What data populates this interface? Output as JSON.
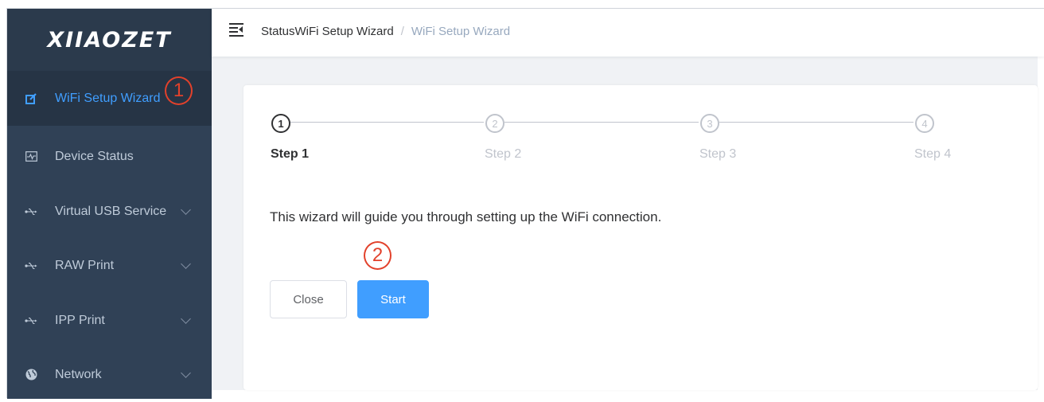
{
  "sidebar": {
    "logo": "XIIAOZET",
    "items": [
      {
        "label": "WiFi Setup Wizard",
        "icon": "edit-square-icon",
        "active": true,
        "has_chevron": false
      },
      {
        "label": "Device Status",
        "icon": "monitor-pulse-icon",
        "active": false,
        "has_chevron": false
      },
      {
        "label": "Virtual USB Service",
        "icon": "usb-icon",
        "active": false,
        "has_chevron": true
      },
      {
        "label": "RAW Print",
        "icon": "usb-icon",
        "active": false,
        "has_chevron": true
      },
      {
        "label": "IPP Print",
        "icon": "usb-icon",
        "active": false,
        "has_chevron": true
      },
      {
        "label": "Network",
        "icon": "globe-icon",
        "active": false,
        "has_chevron": true
      }
    ]
  },
  "annotations": {
    "marker1": "1",
    "marker2": "2",
    "color": "#e2412b"
  },
  "header": {
    "breadcrumb": {
      "root": "StatusWiFi Setup Wizard",
      "separator": "/",
      "current": "WiFi Setup Wizard"
    }
  },
  "wizard": {
    "steps": [
      {
        "number": "1",
        "title": "Step 1",
        "active": true
      },
      {
        "number": "2",
        "title": "Step 2",
        "active": false
      },
      {
        "number": "3",
        "title": "Step 3",
        "active": false
      },
      {
        "number": "4",
        "title": "Step 4",
        "active": false
      }
    ],
    "description": "This wizard will guide you through setting up the WiFi connection.",
    "close_label": "Close",
    "start_label": "Start"
  },
  "colors": {
    "sidebar_bg": "#304156",
    "accent": "#409eff",
    "text": "#303133",
    "muted": "#c0c4cc"
  }
}
